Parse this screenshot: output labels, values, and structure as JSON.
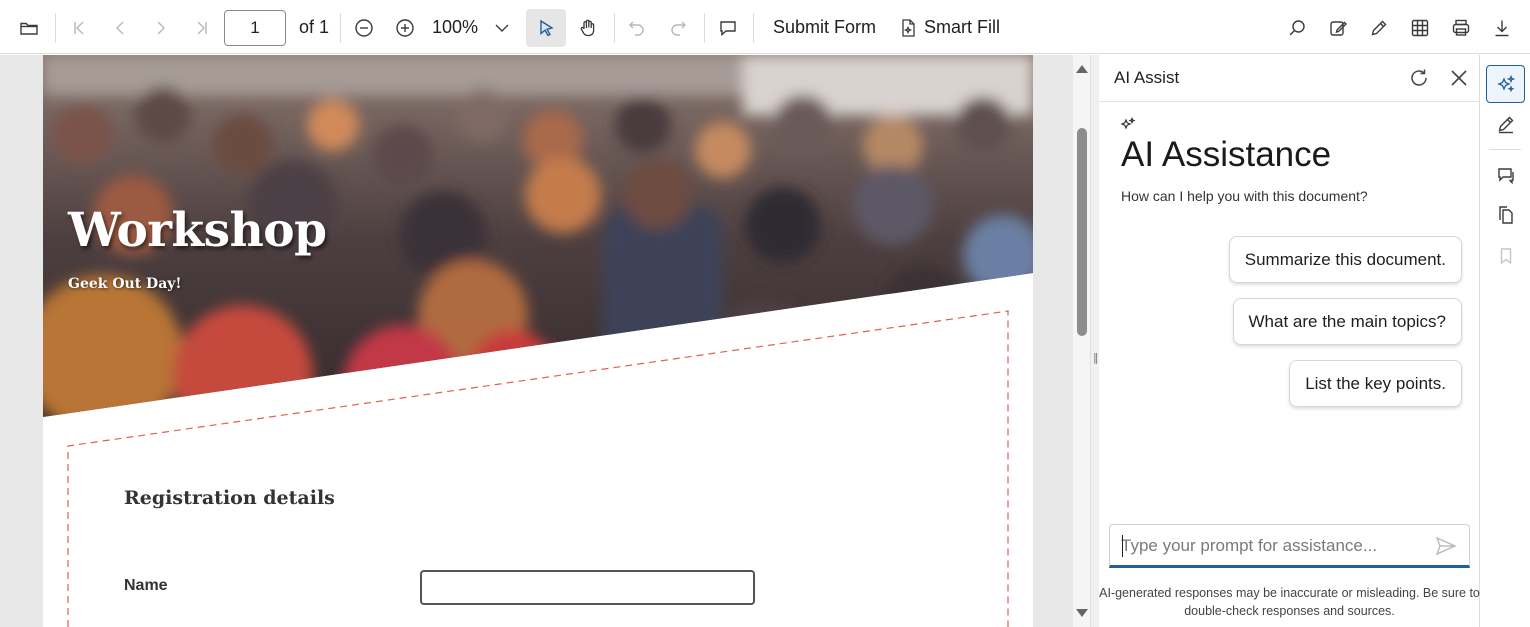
{
  "toolbar": {
    "page_number": "1",
    "page_of": "of 1",
    "zoom": "100%",
    "submit_form": "Submit Form",
    "smart_fill": "Smart Fill",
    "icons": [
      "folder-open-icon",
      "first-page-icon",
      "previous-page-icon",
      "next-page-icon",
      "last-page-icon",
      "zoom-out-icon",
      "zoom-in-icon",
      "chevron-down-icon",
      "select-cursor-icon",
      "pan-hand-icon",
      "undo-icon",
      "redo-icon",
      "comment-icon",
      "smart-fill-icon",
      "search-icon",
      "edit-annotation-icon",
      "pen-icon",
      "form-fields-icon",
      "print-icon",
      "download-icon"
    ]
  },
  "document": {
    "banner_title": "Workshop",
    "banner_subtitle": "Geek Out Day!",
    "section_title": "Registration details",
    "name_label": "Name",
    "name_value": ""
  },
  "ai_panel": {
    "header_title": "AI Assist",
    "heading": "AI Assistance",
    "help_text": "How can I help you with this document?",
    "suggestions": [
      "Summarize this document.",
      "What are the main topics?",
      "List the key points."
    ],
    "prompt_placeholder": "Type your prompt for assistance...",
    "disclaimer_line1": "AI-generated responses may be inaccurate or misleading. Be sure to",
    "disclaimer_line2": "double-check responses and sources.",
    "icons": [
      "refresh-icon",
      "close-icon",
      "sparkle-icon",
      "send-icon"
    ]
  },
  "rail": {
    "icons": [
      "ai-assist-icon",
      "pen-icon",
      "comments-icon",
      "pages-icon",
      "bookmark-icon"
    ]
  },
  "colors": {
    "accent": "#1e5f9e",
    "dashed_border": "#e0614f",
    "toolbar_text": "#212121"
  }
}
